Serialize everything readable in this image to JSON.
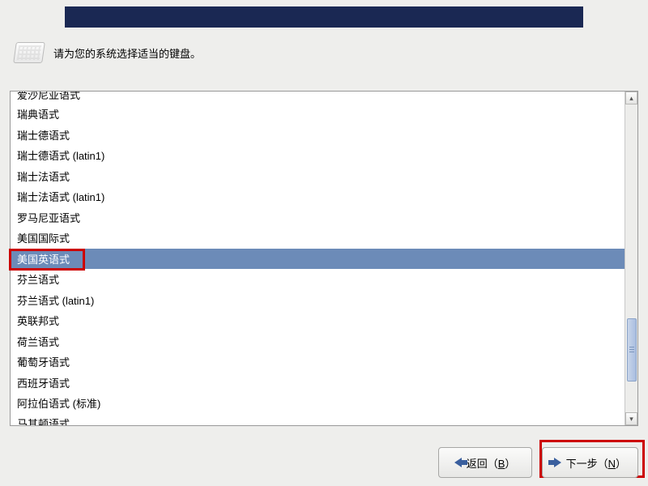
{
  "instruction": "请为您的系统选择适当的键盘。",
  "keyboard_layouts": [
    {
      "label": "爱沙尼亚语式",
      "cutoff": "top"
    },
    {
      "label": "瑞典语式"
    },
    {
      "label": "瑞士德语式"
    },
    {
      "label": "瑞士德语式 (latin1)"
    },
    {
      "label": "瑞士法语式"
    },
    {
      "label": "瑞士法语式 (latin1)"
    },
    {
      "label": "罗马尼亚语式"
    },
    {
      "label": "美国国际式"
    },
    {
      "label": "美国英语式",
      "selected": true
    },
    {
      "label": "芬兰语式"
    },
    {
      "label": "芬兰语式 (latin1)"
    },
    {
      "label": "英联邦式"
    },
    {
      "label": "荷兰语式"
    },
    {
      "label": "葡萄牙语式"
    },
    {
      "label": "西班牙语式"
    },
    {
      "label": "阿拉伯语式 (标准)"
    },
    {
      "label": "马其顿语式",
      "cutoff": "bottom"
    }
  ],
  "buttons": {
    "back_label": "返回（",
    "back_key": "B",
    "back_suffix": "）",
    "next_label": "下一步（",
    "next_key": "N",
    "next_suffix": "）"
  }
}
